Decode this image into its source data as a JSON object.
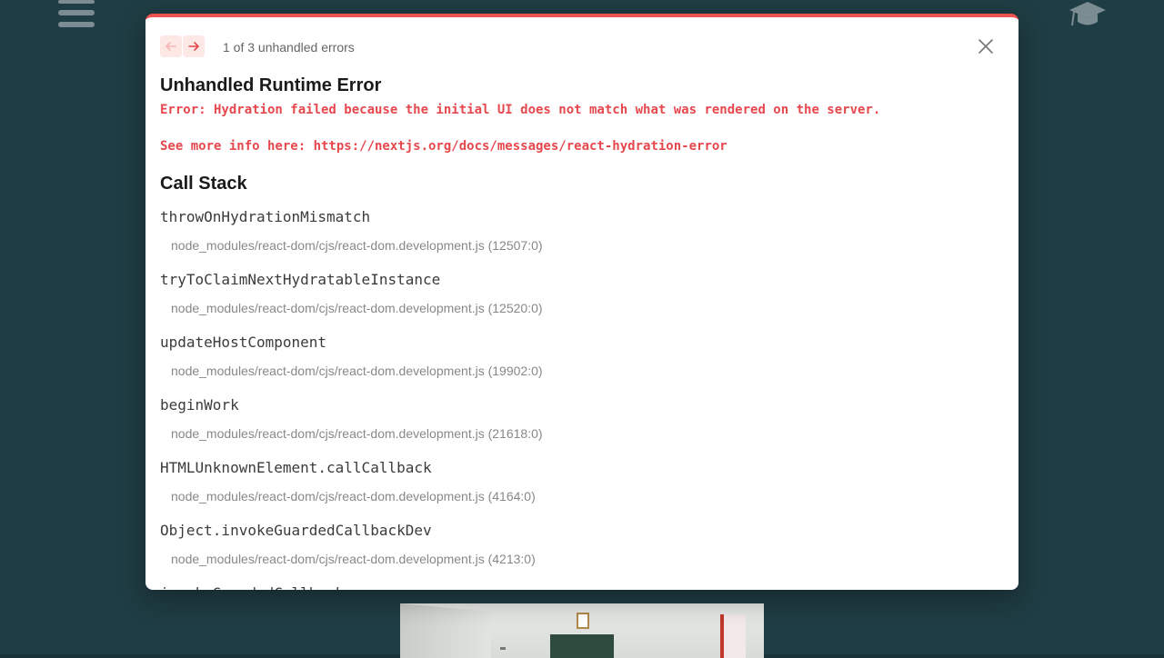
{
  "header": {
    "menu_icon": "hamburger-menu-icon",
    "cap_icon": "graduation-cap-icon"
  },
  "dialog": {
    "accent_color": "#ef5350",
    "nav": {
      "prev_icon": "arrow-left-icon",
      "next_icon": "arrow-right-icon",
      "count_label": "1 of 3 unhandled errors"
    },
    "close_icon": "close-icon",
    "title": "Unhandled Runtime Error",
    "error_message": "Error: Hydration failed because the initial UI does not match what was rendered on the server.",
    "info_line": "See more info here: https://nextjs.org/docs/messages/react-hydration-error",
    "call_stack_title": "Call Stack",
    "frames": [
      {
        "fn": "throwOnHydrationMismatch",
        "loc": "node_modules/react-dom/cjs/react-dom.development.js (12507:0)"
      },
      {
        "fn": "tryToClaimNextHydratableInstance",
        "loc": "node_modules/react-dom/cjs/react-dom.development.js (12520:0)"
      },
      {
        "fn": "updateHostComponent",
        "loc": "node_modules/react-dom/cjs/react-dom.development.js (19902:0)"
      },
      {
        "fn": "beginWork",
        "loc": "node_modules/react-dom/cjs/react-dom.development.js (21618:0)"
      },
      {
        "fn": "HTMLUnknownElement.callCallback",
        "loc": "node_modules/react-dom/cjs/react-dom.development.js (4164:0)"
      },
      {
        "fn": "Object.invokeGuardedCallbackDev",
        "loc": "node_modules/react-dom/cjs/react-dom.development.js (4213:0)"
      },
      {
        "fn": "invokeGuardedCallback",
        "loc": ""
      }
    ]
  }
}
